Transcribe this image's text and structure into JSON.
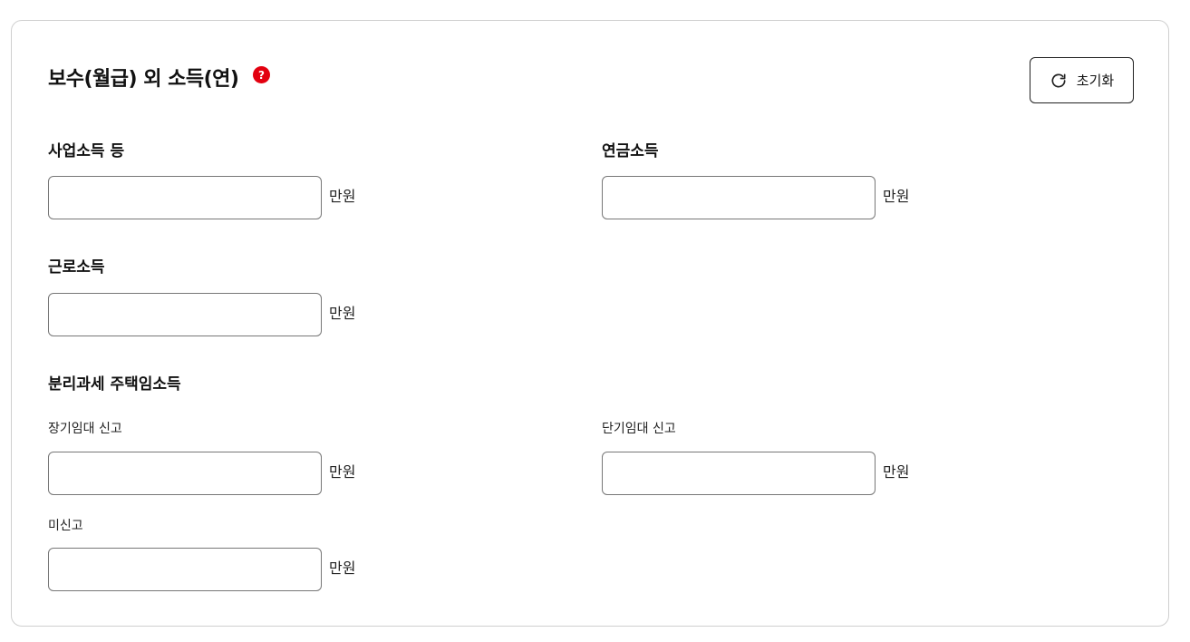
{
  "section": {
    "title": "보수(월급) 외 소득(연)",
    "help_symbol": "?",
    "reset_label": "초기화"
  },
  "fields": {
    "business": {
      "label": "사업소득 등",
      "value": "",
      "unit": "만원"
    },
    "pension": {
      "label": "연금소득",
      "value": "",
      "unit": "만원"
    },
    "earned": {
      "label": "근로소득",
      "value": "",
      "unit": "만원"
    },
    "housing": {
      "label": "분리과세 주택임소득",
      "long_term": {
        "label": "장기임대 신고",
        "value": "",
        "unit": "만원"
      },
      "short_term": {
        "label": "단기임대 신고",
        "value": "",
        "unit": "만원"
      },
      "unreported": {
        "label": "미신고",
        "value": "",
        "unit": "만원"
      }
    }
  },
  "colors": {
    "help_badge": "#e3000f",
    "border": "#cfcfcf",
    "input_border": "#777777"
  }
}
